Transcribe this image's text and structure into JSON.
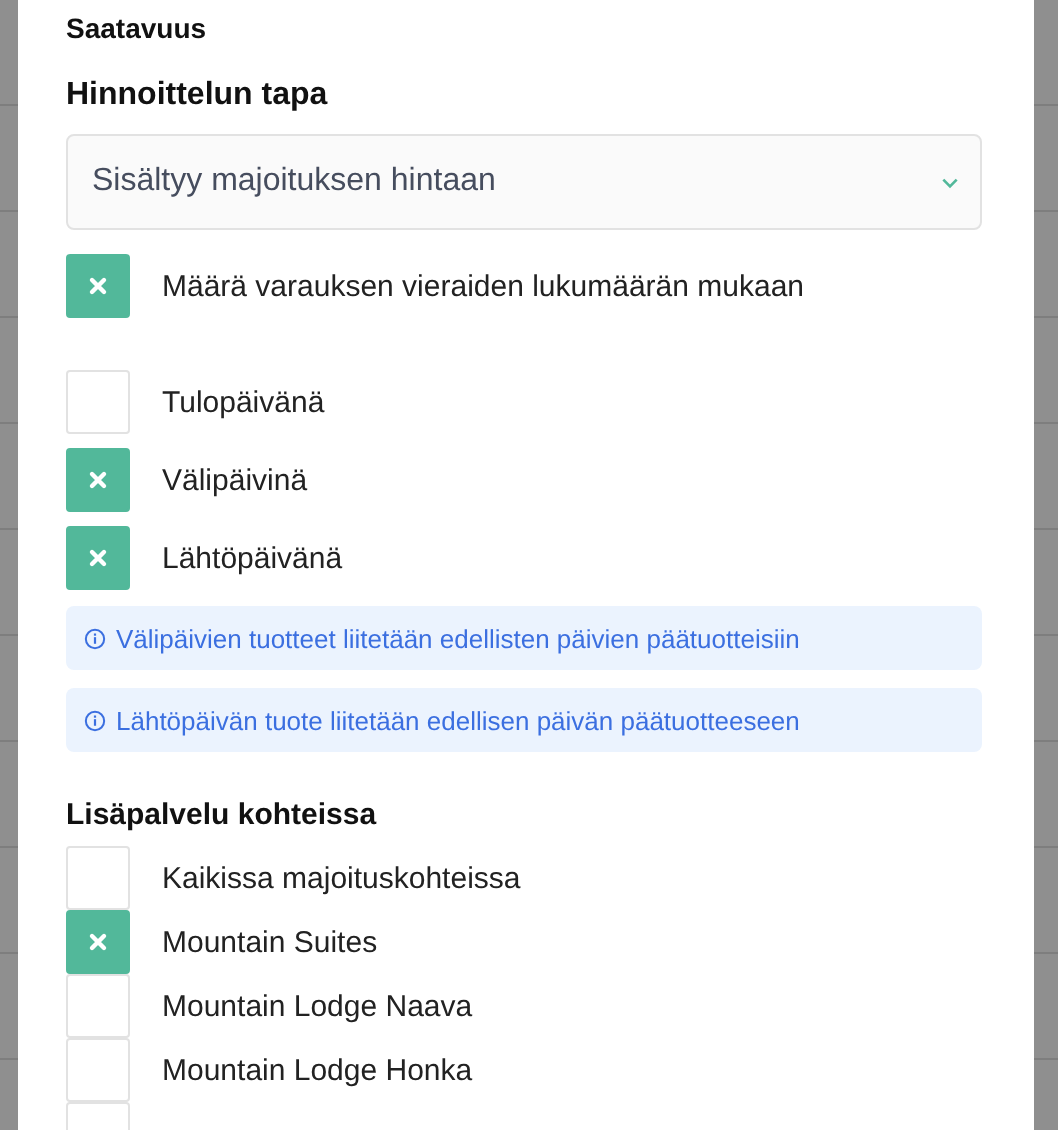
{
  "section_title": "Saatavuus",
  "pricing": {
    "label": "Hinnoittelun tapa",
    "select_value": "Sisältyy majoituksen hintaan"
  },
  "quantity_option": {
    "label": "Määrä varauksen vieraiden lukumäärän mukaan",
    "checked": true
  },
  "days": [
    {
      "label": "Tulopäivänä",
      "checked": false
    },
    {
      "label": "Välipäivinä",
      "checked": true
    },
    {
      "label": "Lähtöpäivänä",
      "checked": true
    }
  ],
  "notices": [
    "Välipäivien tuotteet liitetään edellisten päivien päätuotteisiin",
    "Lähtöpäivän tuote liitetään edellisen päivän päätuotteeseen"
  ],
  "locations": {
    "label": "Lisäpalvelu kohteissa",
    "items": [
      {
        "label": "Kaikissa majoituskohteissa",
        "checked": false
      },
      {
        "label": "Mountain Suites",
        "checked": true
      },
      {
        "label": "Mountain Lodge Naava",
        "checked": false
      },
      {
        "label": "Mountain Lodge Honka",
        "checked": false
      },
      {
        "checked": false
      }
    ]
  }
}
